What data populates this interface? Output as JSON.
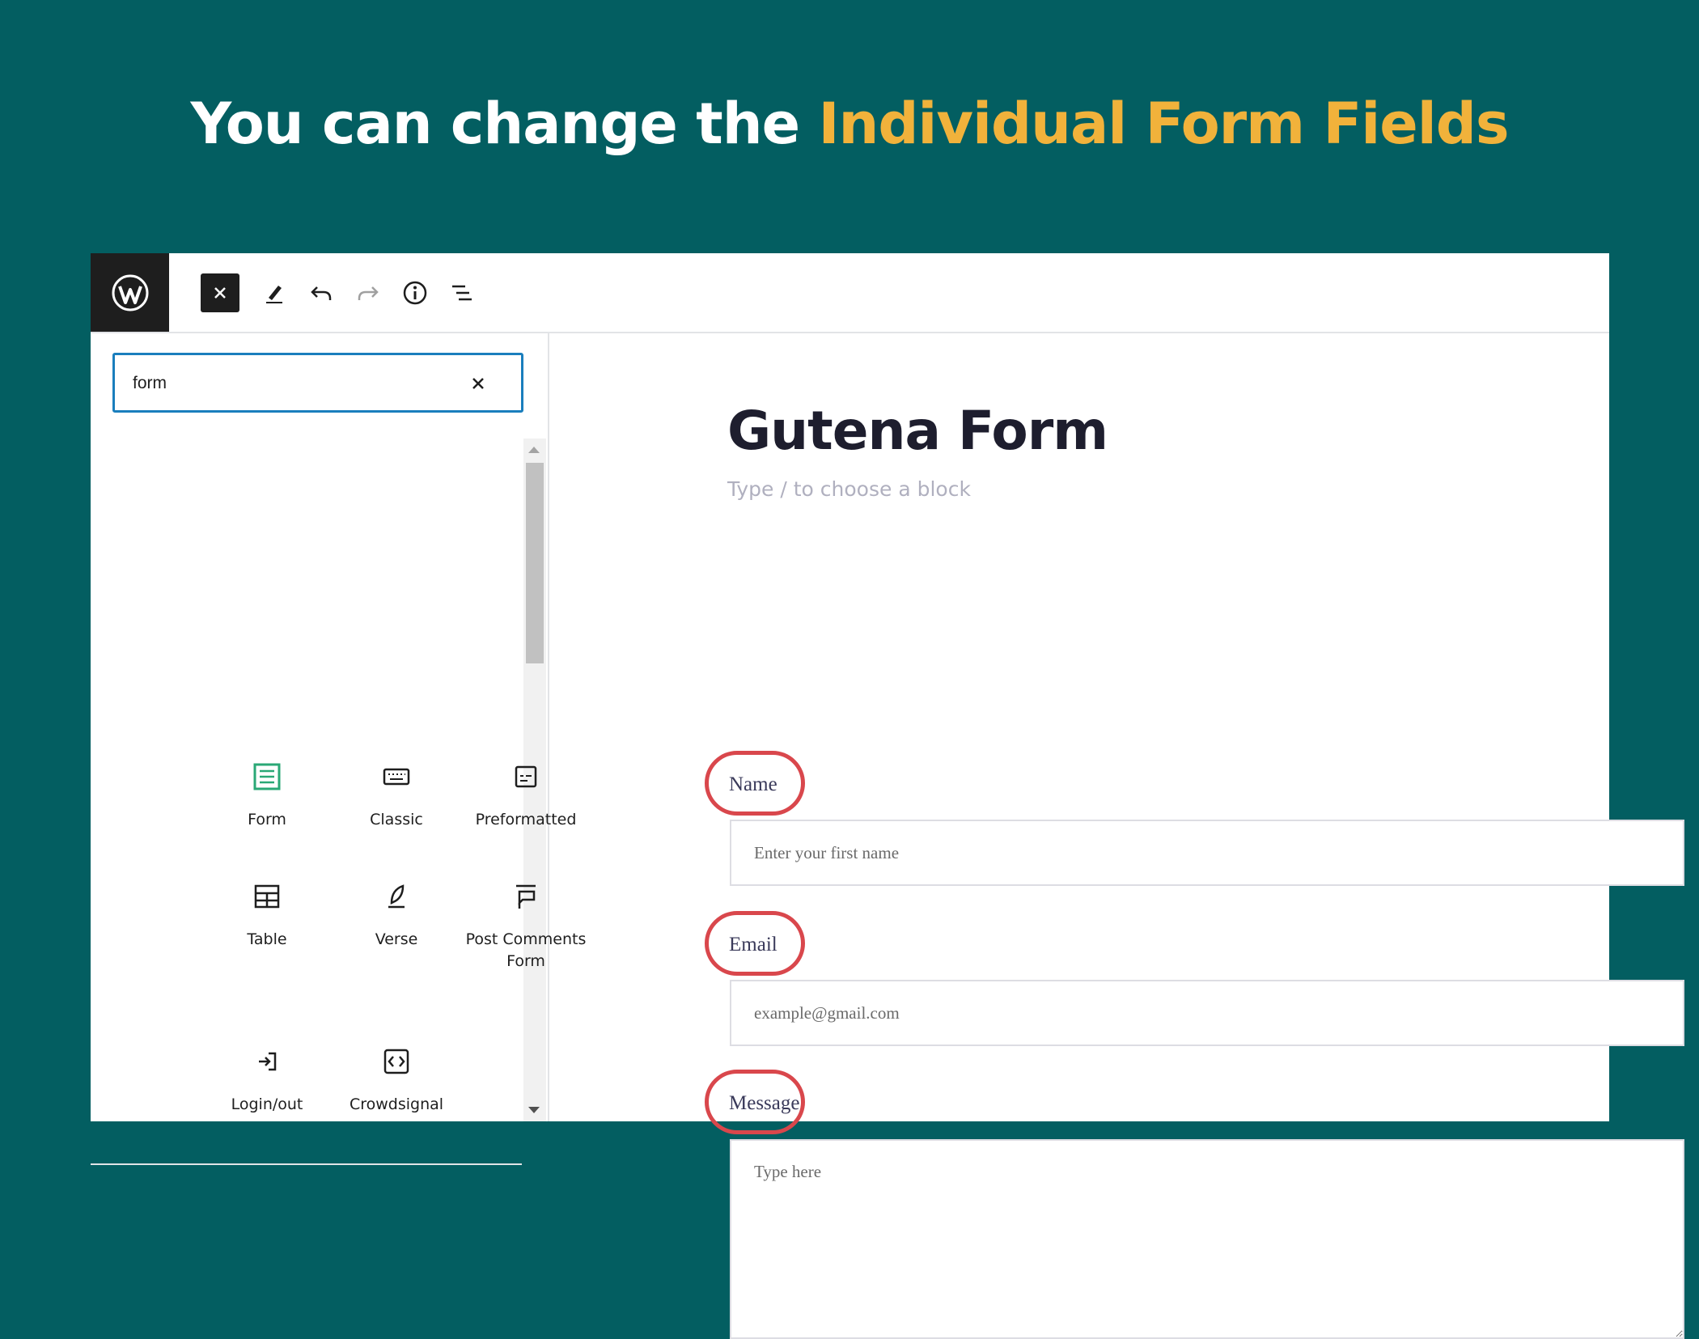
{
  "headline": {
    "prefix": "You can change the ",
    "accent": "Individual Form Fields"
  },
  "toolbar": {
    "logo_icon": "wordpress-icon",
    "close_icon": "close-icon",
    "edit_icon": "pencil-icon",
    "undo_icon": "undo-icon",
    "redo_icon": "redo-icon",
    "info_icon": "info-icon",
    "list_view_icon": "list-view-icon"
  },
  "inserter": {
    "search_value": "form",
    "blocks": [
      {
        "label": "Form",
        "icon": "form-icon",
        "color": "#2aa876"
      },
      {
        "label": "Classic",
        "icon": "keyboard-icon"
      },
      {
        "label": "Preformatted",
        "icon": "preformatted-icon"
      },
      {
        "label": "Table",
        "icon": "table-icon"
      },
      {
        "label": "Verse",
        "icon": "quill-icon"
      },
      {
        "label": "Post Comments Form",
        "icon": "comments-form-icon"
      },
      {
        "label": "Login/out",
        "icon": "login-icon"
      },
      {
        "label": "Crowdsignal",
        "icon": "code-icon"
      }
    ]
  },
  "editor": {
    "title": "Gutena Form",
    "hint": "Type / to choose a block",
    "fields": [
      {
        "label": "Name",
        "placeholder": "Enter your first name"
      },
      {
        "label": "Email",
        "placeholder": "example@gmail.com"
      },
      {
        "label": "Message",
        "placeholder": "Type here"
      }
    ]
  },
  "colors": {
    "background": "#035e61",
    "accent": "#f1b23b",
    "highlight": "#d9474c",
    "focus": "#1a7ebd"
  }
}
